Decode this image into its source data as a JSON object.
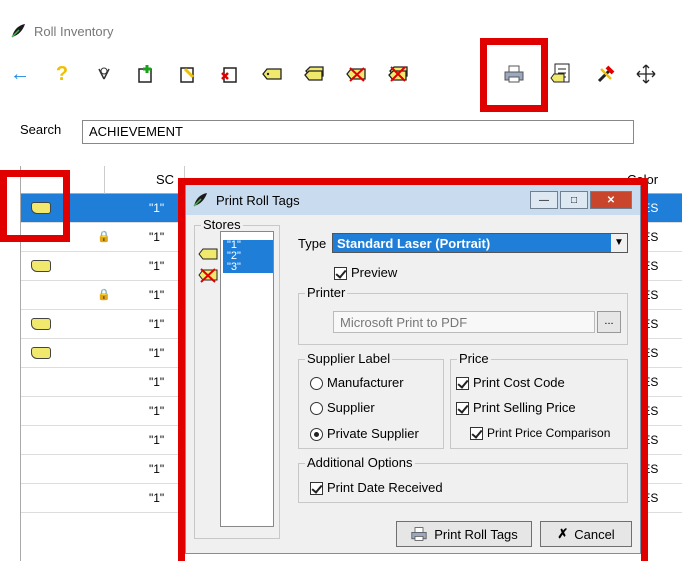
{
  "window": {
    "title": "Roll Inventory"
  },
  "search": {
    "label": "Search",
    "value": "ACHIEVEMENT"
  },
  "grid": {
    "headers": [
      "SC",
      "Color"
    ],
    "rows": [
      {
        "sc": "\"1\"",
        "color": "CCES",
        "tag": true,
        "lock": false,
        "selected": true
      },
      {
        "sc": "\"1\"",
        "color": "CCES",
        "tag": false,
        "lock": true,
        "selected": false
      },
      {
        "sc": "\"1\"",
        "color": "CCES",
        "tag": true,
        "lock": false,
        "selected": false
      },
      {
        "sc": "\"1\"",
        "color": "CCES",
        "tag": false,
        "lock": true,
        "selected": false
      },
      {
        "sc": "\"1\"",
        "color": "CCES",
        "tag": true,
        "lock": false,
        "selected": false
      },
      {
        "sc": "\"1\"",
        "color": "CCES",
        "tag": true,
        "lock": false,
        "selected": false
      },
      {
        "sc": "\"1\"",
        "color": "CCES",
        "tag": false,
        "lock": false,
        "selected": false
      },
      {
        "sc": "\"1\"",
        "color": "CCES",
        "tag": false,
        "lock": false,
        "selected": false
      },
      {
        "sc": "\"1\"",
        "color": "CCES",
        "tag": false,
        "lock": false,
        "selected": false
      },
      {
        "sc": "\"1\"",
        "color": "CCES",
        "tag": false,
        "lock": false,
        "selected": false
      },
      {
        "sc": "\"1\"",
        "color": "CCES",
        "tag": false,
        "lock": false,
        "selected": false
      }
    ]
  },
  "dialog": {
    "title": "Print Roll Tags",
    "stores_label": "Stores",
    "stores": [
      "\"1\"",
      "\"2\"",
      "\"3\""
    ],
    "type_label": "Type",
    "type_value": "Standard Laser (Portrait)",
    "preview_label": "Preview",
    "printer_label": "Printer",
    "printer_value": "Microsoft Print to PDF",
    "browse_label": "...",
    "supplier_label": {
      "title": "Supplier Label",
      "options": [
        "Manufacturer",
        "Supplier",
        "Private Supplier"
      ],
      "selected": "Private Supplier"
    },
    "price": {
      "title": "Price",
      "cost_code": "Print Cost Code",
      "selling_price": "Print Selling Price",
      "price_comparison": "Print Price Comparison"
    },
    "additional": {
      "title": "Additional Options",
      "date_received": "Print Date Received"
    },
    "print_button": "Print Roll Tags",
    "cancel_button": "Cancel"
  },
  "colors": {
    "selection": "#1e7ed8",
    "highlight": "#e00000",
    "dialog_title": "#c9dbef"
  }
}
